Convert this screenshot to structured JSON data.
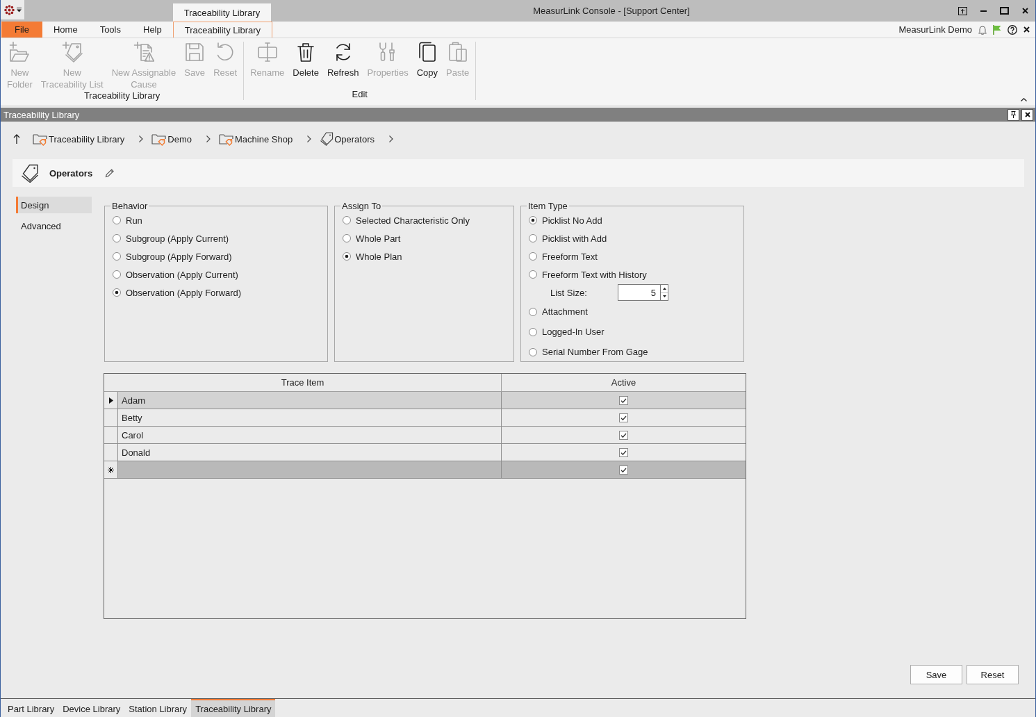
{
  "title_bar": {
    "context_tab": "Traceability Library",
    "title": "MeasurLink Console - [Support Center]"
  },
  "menu": {
    "tabs": [
      {
        "label": "File",
        "kind": "backstage",
        "selected": false
      },
      {
        "label": "Home",
        "kind": "tab",
        "selected": false
      },
      {
        "label": "Tools",
        "kind": "tab",
        "selected": false
      },
      {
        "label": "Help",
        "kind": "tab",
        "selected": false
      },
      {
        "label": "Traceability Library",
        "kind": "tab",
        "selected": true
      }
    ],
    "user": "MeasurLink Demo"
  },
  "ribbon": {
    "groups": [
      {
        "label": "Traceability Library",
        "buttons": [
          {
            "label": "New\nFolder",
            "disabled": true
          },
          {
            "label": "New\nTraceability List",
            "disabled": true
          },
          {
            "label": "New Assignable\nCause",
            "disabled": true
          },
          {
            "label": "Save",
            "disabled": true
          },
          {
            "label": "Reset",
            "disabled": true
          }
        ]
      },
      {
        "label": "Edit",
        "buttons": [
          {
            "label": "Rename",
            "disabled": true
          },
          {
            "label": "Delete",
            "disabled": false
          },
          {
            "label": "Refresh",
            "disabled": false
          },
          {
            "label": "Properties",
            "disabled": true
          },
          {
            "label": "Copy",
            "disabled": false
          },
          {
            "label": "Paste",
            "disabled": true
          }
        ]
      }
    ]
  },
  "panel": {
    "title": "Traceability Library"
  },
  "breadcrumb": [
    {
      "label": "Traceability Library",
      "kind": "folder"
    },
    {
      "label": "Demo",
      "kind": "folder"
    },
    {
      "label": "Machine Shop",
      "kind": "folder"
    },
    {
      "label": "Operators",
      "kind": "list"
    }
  ],
  "item": {
    "name": "Operators"
  },
  "nav": [
    {
      "label": "Design",
      "selected": true
    },
    {
      "label": "Advanced",
      "selected": false
    }
  ],
  "behavior": {
    "title": "Behavior",
    "options": [
      {
        "label": "Run",
        "selected": false
      },
      {
        "label": "Subgroup (Apply Current)",
        "selected": false
      },
      {
        "label": "Subgroup (Apply Forward)",
        "selected": false
      },
      {
        "label": "Observation (Apply Current)",
        "selected": false
      },
      {
        "label": "Observation (Apply Forward)",
        "selected": true
      }
    ]
  },
  "assign_to": {
    "title": "Assign To",
    "options": [
      {
        "label": "Selected Characteristic Only",
        "selected": false
      },
      {
        "label": "Whole Part",
        "selected": false
      },
      {
        "label": "Whole Plan",
        "selected": true
      }
    ]
  },
  "item_type": {
    "title": "Item Type",
    "options": [
      {
        "kind": "radio",
        "label": "Picklist No Add",
        "selected": true
      },
      {
        "kind": "radio",
        "label": "Picklist with Add",
        "selected": false
      },
      {
        "kind": "radio",
        "label": "Freeform Text",
        "selected": false
      },
      {
        "kind": "radio",
        "label": "Freeform Text with History",
        "selected": false
      },
      {
        "kind": "spinner",
        "label": "List Size:",
        "value": "5"
      },
      {
        "kind": "radio",
        "label": "Attachment",
        "selected": false
      },
      {
        "kind": "radio",
        "label": "Logged-In User",
        "selected": false
      },
      {
        "kind": "radio",
        "label": "Serial Number From Gage",
        "selected": false
      }
    ]
  },
  "table": {
    "columns": [
      "Trace Item",
      "Active"
    ],
    "rows": [
      {
        "kind": "data",
        "name": "Adam",
        "active": true,
        "selected": true
      },
      {
        "kind": "data",
        "name": "Betty",
        "active": true,
        "selected": false
      },
      {
        "kind": "data",
        "name": "Carol",
        "active": true,
        "selected": false
      },
      {
        "kind": "data",
        "name": "Donald",
        "active": true,
        "selected": false
      },
      {
        "kind": "new",
        "active": true,
        "selected": false
      }
    ]
  },
  "footer_buttons": [
    "Save",
    "Reset"
  ],
  "document_tabs": [
    {
      "label": "Part Library",
      "selected": false
    },
    {
      "label": "Device Library",
      "selected": false
    },
    {
      "label": "Station Library",
      "selected": false
    },
    {
      "label": "Traceability Library",
      "selected": true
    }
  ]
}
